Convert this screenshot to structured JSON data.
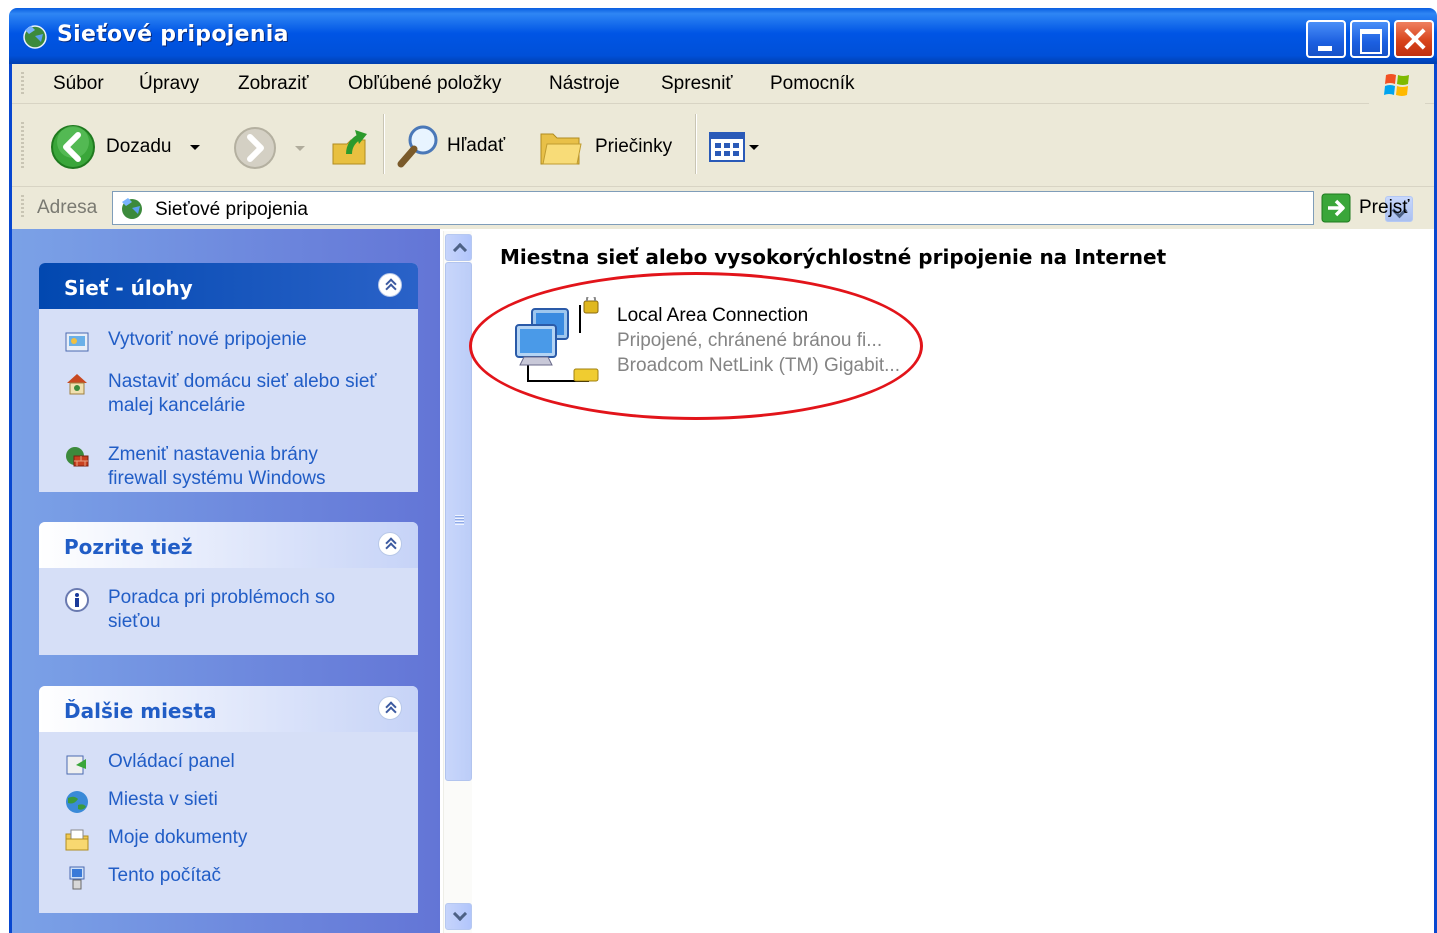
{
  "window": {
    "title": "Sieťové pripojenia",
    "controls": {
      "minimize": "minimize",
      "maximize": "maximize",
      "close": "close"
    }
  },
  "menubar": {
    "items": [
      "Súbor",
      "Úpravy",
      "Zobraziť",
      "Obľúbené položky",
      "Nástroje",
      "Spresniť",
      "Pomocník"
    ]
  },
  "toolbar": {
    "back_label": "Dozadu",
    "search_label": "Hľadať",
    "folders_label": "Priečinky"
  },
  "address": {
    "label": "Adresa",
    "value": "Sieťové pripojenia",
    "go_label": "Prejsť"
  },
  "sidebar": {
    "network_tasks": {
      "title": "Sieť - úlohy",
      "links": [
        {
          "label": "Vytvoriť nové pripojenie",
          "icon": "new-connection-icon"
        },
        {
          "label": "Nastaviť domácu sieť alebo sieť malej kancelárie",
          "icon": "home-network-icon"
        },
        {
          "label": "Zmeniť nastavenia brány firewall systému Windows",
          "icon": "firewall-icon"
        }
      ]
    },
    "see_also": {
      "title": "Pozrite tiež",
      "links": [
        {
          "label": "Poradca pri problémoch so sieťou",
          "icon": "info-icon"
        }
      ]
    },
    "other_places": {
      "title": "Ďalšie miesta",
      "links": [
        {
          "label": "Ovládací panel",
          "icon": "control-panel-icon"
        },
        {
          "label": "Miesta v sieti",
          "icon": "network-places-icon"
        },
        {
          "label": "Moje dokumenty",
          "icon": "my-documents-icon"
        },
        {
          "label": "Tento počítač",
          "icon": "my-computer-icon"
        }
      ]
    }
  },
  "content": {
    "group_title": "Miestna sieť alebo vysokorýchlostné pripojenie na Internet",
    "connection": {
      "name": "Local Area Connection",
      "status": "Pripojené, chránené bránou fi...",
      "device": "Broadcom NetLink (TM) Gigabit..."
    }
  },
  "colors": {
    "titlebar": "#0055e5",
    "sidebar_bg": "#7ba2e7",
    "task_link": "#215dc6",
    "highlight": "#e2141a"
  }
}
